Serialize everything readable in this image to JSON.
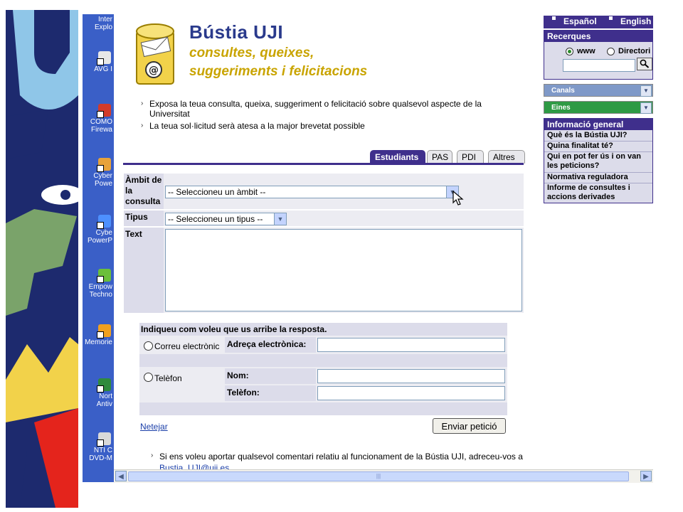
{
  "desktop": {
    "icons": [
      {
        "label_1": "Inter",
        "label_2": "Explo",
        "icon": "internet-explorer-icon",
        "color": "#2b74d9"
      },
      {
        "label_1": "",
        "label_2": "AVG I",
        "icon": "avg-antivirus-icon",
        "color": "#e7e7e7"
      },
      {
        "label_1": "COMO",
        "label_2": "Firewa",
        "icon": "comodo-firewall-icon",
        "color": "#d23b2b"
      },
      {
        "label_1": "Cyber",
        "label_2": "Powe",
        "icon": "cyberlink-power-icon",
        "color": "#e8a23a"
      },
      {
        "label_1": "Cybe",
        "label_2": "PowerP",
        "icon": "cyberlink-powerproducer-icon",
        "color": "#4d90fe"
      },
      {
        "label_1": "Empow",
        "label_2": "Techno",
        "icon": "empowering-technology-icon",
        "color": "#6bbf3a"
      },
      {
        "label_1": "",
        "label_2": "Memorie",
        "icon": "memories-icon",
        "color": "#f0a020"
      },
      {
        "label_1": "Nort",
        "label_2": "Antiv",
        "icon": "norton-antivirus-icon",
        "color": "#2f8a3d"
      },
      {
        "label_1": "NTI C",
        "label_2": "DVD-M",
        "icon": "nti-dvd-maker-icon",
        "color": "#d9d9d9"
      }
    ]
  },
  "brand": {
    "title": "Bústia UJI",
    "subtitle_1": "consultes, queixes,",
    "subtitle_2": "suggeriments i felicitacions"
  },
  "intro": {
    "line_1": "Exposa la teua consulta, queixa, suggeriment o felicitació sobre qualsevol aspecte de la Universitat",
    "line_2": "La teua sol·licitud serà atesa a la major brevetat possible"
  },
  "tabs": [
    {
      "label": "Estudiants",
      "active": true
    },
    {
      "label": "PAS",
      "active": false
    },
    {
      "label": "PDI",
      "active": false
    },
    {
      "label": "Altres",
      "active": false
    }
  ],
  "form": {
    "ambit_label": "Àmbit de la consulta",
    "ambit_value": "-- Seleccioneu un àmbit --",
    "tipus_label": "Tipus",
    "tipus_value": "-- Seleccioneu un tipus --",
    "text_label": "Text",
    "text_value": ""
  },
  "response": {
    "title": "Indiqueu com voleu que us arribe la resposta.",
    "email_option": "Correu electrònic",
    "email_label": "Adreça electrònica:",
    "email_value": "",
    "phone_option": "Telèfon",
    "name_label": "Nom:",
    "name_value": "",
    "phone_label": "Telèfon:",
    "phone_value": ""
  },
  "actions": {
    "reset_label": "Netejar",
    "submit_label": "Enviar petició"
  },
  "footer": {
    "note": "Si ens voleu aportar qualsevol comentari relatiu al funcionament de la Bústia UJI, adreceu-vos a",
    "email": "Bustia_UJI@uji.es",
    "suffix": "."
  },
  "sidebar": {
    "lang_es": "Español",
    "lang_en": "English",
    "recerques_title": "Recerques",
    "search_opt_www": "www",
    "search_opt_dir": "Directori",
    "search_value": "",
    "canals": "Canals",
    "eines": "Eines",
    "info_title": "Informació general",
    "info_items": [
      "Què és la Bústia UJI?",
      "Quina finalitat té?",
      "Qui en pot fer ús i on van les peticions?",
      "Normativa reguladora",
      "Informe de consultes i accions derivades"
    ]
  },
  "colors": {
    "accent": "#3f2f8c",
    "brand_gold": "#c9a400",
    "link": "#1a3ea8",
    "eines_green": "#2e9a44",
    "canals_blue": "#7f99c8"
  }
}
